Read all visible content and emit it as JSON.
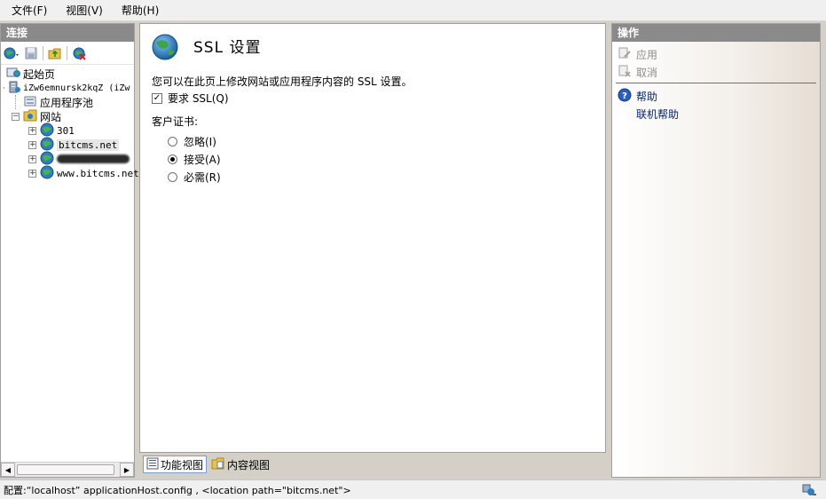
{
  "menu": {
    "items": [
      "文件(F)",
      "视图(V)",
      "帮助(H)"
    ]
  },
  "connections": {
    "header": "连接",
    "tree": {
      "start_page": "起始页",
      "server": "iZw6emnursk2kqZ (iZw",
      "app_pools": "应用程序池",
      "sites": "网站",
      "site_items": [
        "301",
        "bitcms.net",
        "",
        "www.bitcms.net"
      ]
    }
  },
  "content": {
    "title": "SSL 设置",
    "description": "您可以在此页上修改网站或应用程序内容的 SSL 设置。",
    "require_ssl_label": "要求 SSL(Q)",
    "require_ssl_checked": true,
    "client_cert_label": "客户证书:",
    "radio_options": [
      {
        "label": "忽略(I)",
        "checked": false
      },
      {
        "label": "接受(A)",
        "checked": true
      },
      {
        "label": "必需(R)",
        "checked": false
      }
    ]
  },
  "view_tabs": {
    "features_view": "功能视图",
    "content_view": "内容视图"
  },
  "actions": {
    "header": "操作",
    "apply": "应用",
    "cancel": "取消",
    "help": "帮助",
    "online_help": "联机帮助"
  },
  "status": {
    "text": "配置:“localhost” applicationHost.config , <location path=\"bitcms.net\">"
  },
  "colors": {
    "panel_header": "#8a8a8a",
    "link": "#0a246a",
    "disabled": "#8c8c8c"
  }
}
